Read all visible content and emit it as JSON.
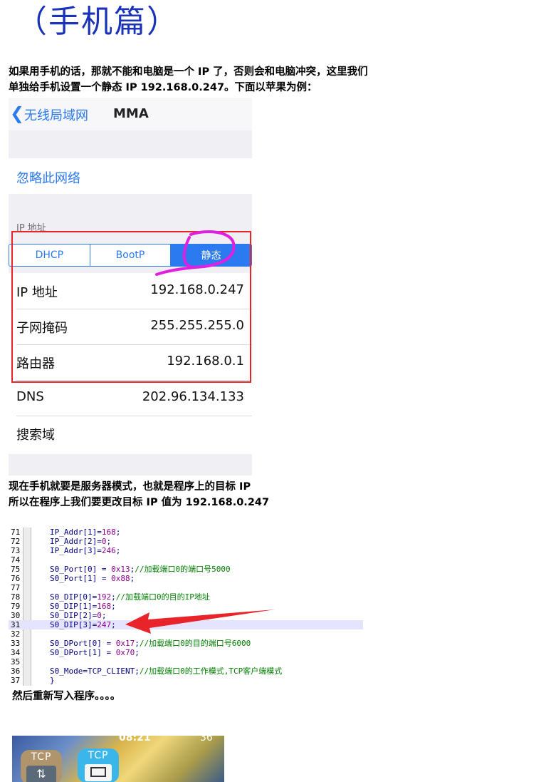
{
  "title": "（手机篇）",
  "intro": {
    "line1": "如果用手机的话，那就不能和电脑是一个 IP 了，否则会和电脑冲突，这里我们",
    "line2": "单独给手机设置一个静态 IP 192.168.0.247。下面以苹果为例："
  },
  "phone": {
    "back_label": "无线局域网",
    "ssid": "MMA",
    "forget": "忽略此网络",
    "ip_header": "IP 地址",
    "segments": [
      "DHCP",
      "BootP",
      "静态"
    ],
    "rows": [
      {
        "key": "IP 地址",
        "value": "192.168.0.247"
      },
      {
        "key": "子网掩码",
        "value": "255.255.255.0"
      },
      {
        "key": "路由器",
        "value": "192.168.0.1"
      },
      {
        "key": "DNS",
        "value": "202.96.134.133"
      },
      {
        "key": "搜索域",
        "value": ""
      }
    ],
    "colors": {
      "accent": "#2b7af0",
      "highlight_box": "#e8232a",
      "annotation": "#e020e0"
    }
  },
  "middle": {
    "line1": "现在手机就要是服务器模式，也就是程序上的目标 IP",
    "line2": "所以在程序上我们要更改目标 IP 值为  192.168.0.247"
  },
  "code": [
    {
      "ln": "71",
      "pre": "IP_Addr[1]=",
      "num": "168",
      "post": ";",
      "cmt": ""
    },
    {
      "ln": "72",
      "pre": "IP_Addr[2]=",
      "num": "0",
      "post": ";",
      "cmt": ""
    },
    {
      "ln": "73",
      "pre": "IP_Addr[3]=",
      "num": "246",
      "post": ";",
      "cmt": ""
    },
    {
      "ln": "74",
      "pre": "",
      "num": "",
      "post": "",
      "cmt": ""
    },
    {
      "ln": "75",
      "pre": "S0_Port[0] = ",
      "num": "0x13",
      "post": ";",
      "cmt": "//加载端口0的端口号5000"
    },
    {
      "ln": "76",
      "pre": "S0_Port[1] = ",
      "num": "0x88",
      "post": ";",
      "cmt": ""
    },
    {
      "ln": "77",
      "pre": "",
      "num": "",
      "post": "",
      "cmt": ""
    },
    {
      "ln": "78",
      "pre": "S0_DIP[0]=",
      "num": "192",
      "post": ";",
      "cmt": "//加载端口0的目的IP地址"
    },
    {
      "ln": "79",
      "pre": "S0_DIP[1]=",
      "num": "168",
      "post": ";",
      "cmt": ""
    },
    {
      "ln": "30",
      "pre": "S0_DIP[2]=",
      "num": "0",
      "post": ";",
      "cmt": ""
    },
    {
      "ln": "31",
      "pre": "S0_DIP[3]=",
      "num": "247",
      "post": ";",
      "cmt": ""
    },
    {
      "ln": "32",
      "pre": "",
      "num": "",
      "post": "",
      "cmt": ""
    },
    {
      "ln": "33",
      "pre": "S0_DPort[0] = ",
      "num": "0x17",
      "post": ";",
      "cmt": "//加载端口0的目的端口号6000"
    },
    {
      "ln": "34",
      "pre": "S0_DPort[1] = ",
      "num": "0x70",
      "post": ";",
      "cmt": ""
    },
    {
      "ln": "35",
      "pre": "",
      "num": "",
      "post": "",
      "cmt": ""
    },
    {
      "ln": "36",
      "pre": "S0_Mode=TCP_CLIENT;",
      "num": "",
      "post": "",
      "cmt": "//加载端口0的工作模式,TCP客户端模式"
    },
    {
      "ln": "37",
      "pre": "}",
      "num": "",
      "post": "",
      "cmt": ""
    }
  ],
  "after": "然后重新写入程序。。。。",
  "phone2": {
    "time": "08:21",
    "battery": "36",
    "apps": [
      "TCP",
      "TCP"
    ]
  }
}
